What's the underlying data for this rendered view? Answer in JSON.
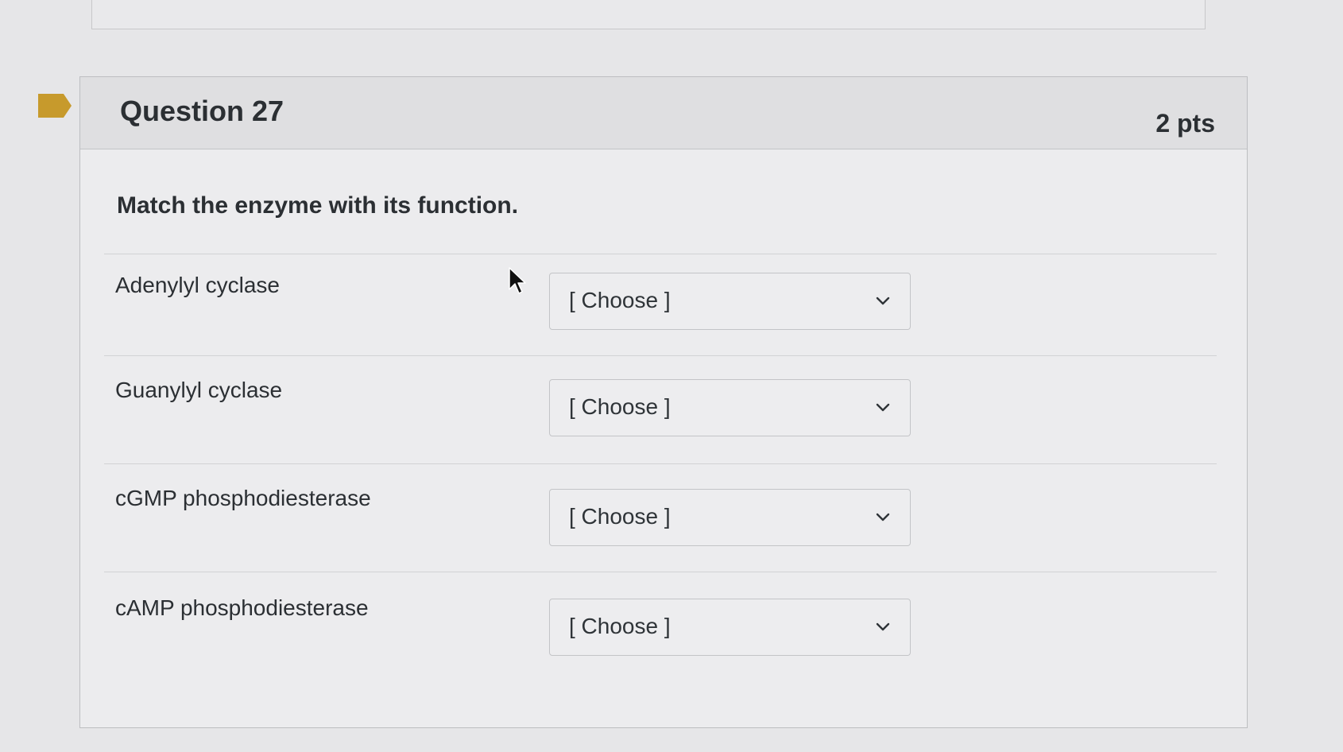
{
  "question": {
    "title": "Question 27",
    "points": "2 pts",
    "prompt": "Match the enzyme with its function."
  },
  "matches": [
    {
      "label": "Adenylyl cyclase",
      "selected": "[ Choose ]"
    },
    {
      "label": "Guanylyl cyclase",
      "selected": "[ Choose ]"
    },
    {
      "label": "cGMP phosphodiesterase",
      "selected": "[ Choose ]"
    },
    {
      "label": "cAMP phosphodiesterase",
      "selected": "[ Choose ]"
    }
  ],
  "colors": {
    "flag": "#c79a2c",
    "header_bg": "#dfdfe1",
    "text": "#2b2f33"
  },
  "icons": {
    "flag": "flag-icon",
    "dropdown": "chevron-down-icon",
    "cursor": "mouse-cursor-icon"
  }
}
